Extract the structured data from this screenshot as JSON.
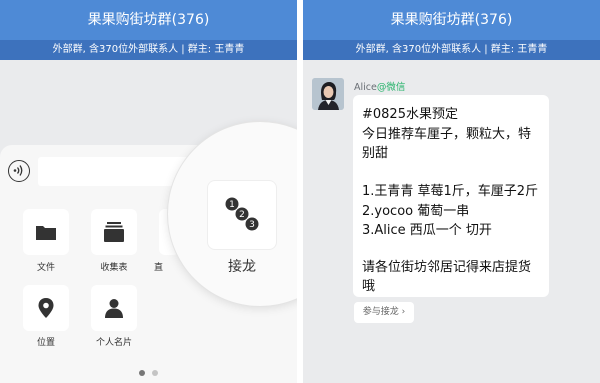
{
  "left": {
    "header": {
      "title": "果果购街坊群(376)",
      "subtitle": "外部群, 含370位外部联系人 | 群主: 王青青"
    },
    "tools": [
      {
        "label": "文件",
        "icon": "folder-icon"
      },
      {
        "label": "收集表",
        "icon": "collection-form-icon"
      },
      {
        "label": "直",
        "icon": "live-icon"
      },
      {
        "label": "位置",
        "icon": "location-pin-icon"
      },
      {
        "label": "个人名片",
        "icon": "contact-card-icon"
      }
    ],
    "magnified_tool": {
      "label": "接龙",
      "icon": "relay-list-icon"
    },
    "pager": {
      "pages": 2,
      "current": 1
    }
  },
  "right": {
    "header": {
      "title": "果果购街坊群(376)",
      "subtitle": "外部群, 含370位外部联系人 | 群主: 王青青"
    },
    "message": {
      "sender": "Alice",
      "sender_source": "@微信",
      "lines": [
        "#0825水果预定",
        "今日推荐车厘子，颗粒大，特",
        "别甜",
        "",
        "1.王青青  草莓1斤，车厘子2斤",
        "2.yocoo  葡萄一串",
        "3.Alice  西瓜一个  切开",
        "",
        "请各位街坊邻居记得来店提货",
        "哦"
      ],
      "action_label": "参与接龙 ›"
    }
  },
  "colors": {
    "header": "#4e8ad6",
    "subheader": "#3d72bd",
    "wechat_green": "#27b36b",
    "background": "#eaebed"
  }
}
